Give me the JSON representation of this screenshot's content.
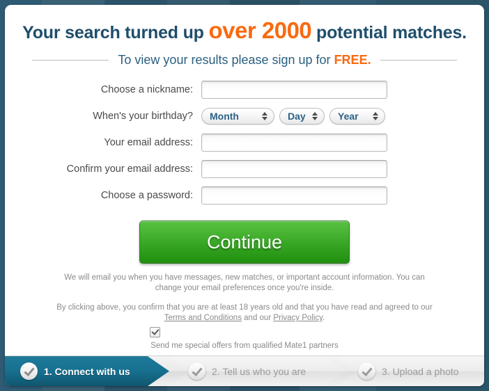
{
  "theme": {
    "backdrop": "#2c5871",
    "card_bg": "#ffffff",
    "accent_orange": "#f96a10",
    "headline_blue": "#1f4e6b",
    "subhead_blue": "#2a5f80",
    "button_green": "#2f9e1c",
    "active_step_teal": "#177090",
    "muted_gray": "#8a8a8a"
  },
  "headline": {
    "prefix": "Your search turned up ",
    "highlight": "over 2000",
    "suffix": " potential matches."
  },
  "subheadline": {
    "text": "To view your results please sign up for ",
    "highlight": "FREE."
  },
  "form": {
    "fields": [
      {
        "label": "Choose a nickname:",
        "type": "text",
        "value": "",
        "placeholder": "",
        "name": "nickname"
      },
      {
        "label": "When's your birthday?",
        "type": "date-selects",
        "name": "birthday"
      },
      {
        "label": "Your email address:",
        "type": "text",
        "value": "",
        "placeholder": "",
        "name": "email"
      },
      {
        "label": "Confirm your email address:",
        "type": "text",
        "value": "",
        "placeholder": "",
        "name": "email-confirm"
      },
      {
        "label": "Choose a password:",
        "type": "password",
        "value": "",
        "placeholder": "",
        "name": "password"
      }
    ],
    "birthday_selects": [
      {
        "value": "Month",
        "name": "month"
      },
      {
        "value": "Day",
        "name": "day"
      },
      {
        "value": "Year",
        "name": "year"
      }
    ],
    "submit_label": "Continue"
  },
  "fineprint": {
    "email_notice": "We will email you when you have messages, new matches, or important account information. You can change your email preferences once you're inside.",
    "terms_part1": "By clicking above, you confirm that you are at least 18 years old and that you have read and agreed to our ",
    "terms_link": "Terms and Conditions",
    "terms_part2": " and our ",
    "privacy_link": "Privacy Policy",
    "terms_part3": "."
  },
  "optin": {
    "checked": true,
    "label": "Send me special offers from qualified Mate1 partners"
  },
  "steps": [
    {
      "label": "1. Connect with us",
      "active": true,
      "icon": "check-icon"
    },
    {
      "label": "2. Tell us who you are",
      "active": false,
      "icon": "check-icon"
    },
    {
      "label": "3. Upload a photo",
      "active": false,
      "icon": "check-icon"
    }
  ]
}
